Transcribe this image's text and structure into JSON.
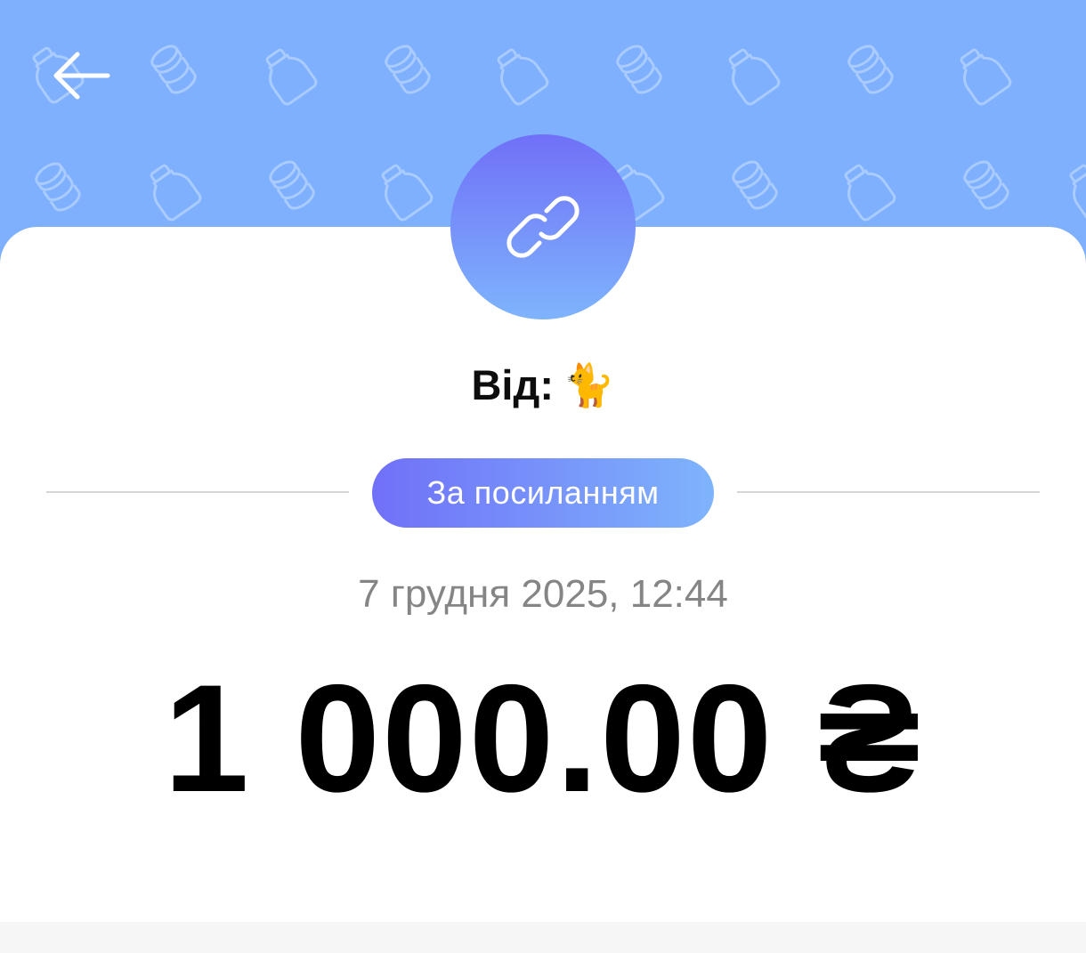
{
  "header": {
    "back_icon": "arrow-left-icon",
    "background_color": "#7fb0fd",
    "pattern_icons": [
      "coins-icon",
      "jar-icon"
    ]
  },
  "transfer": {
    "avatar_icon": "link-icon",
    "sender_label": "Від:",
    "sender_emoji": "🐈",
    "type_label": "За посиланням",
    "date": "7 грудня 2025, 12:44",
    "amount": "1 000.00 ₴"
  },
  "colors": {
    "accent_gradient_start": "#7070f8",
    "accent_gradient_end": "#7eb4fc",
    "date_text": "#858585"
  }
}
